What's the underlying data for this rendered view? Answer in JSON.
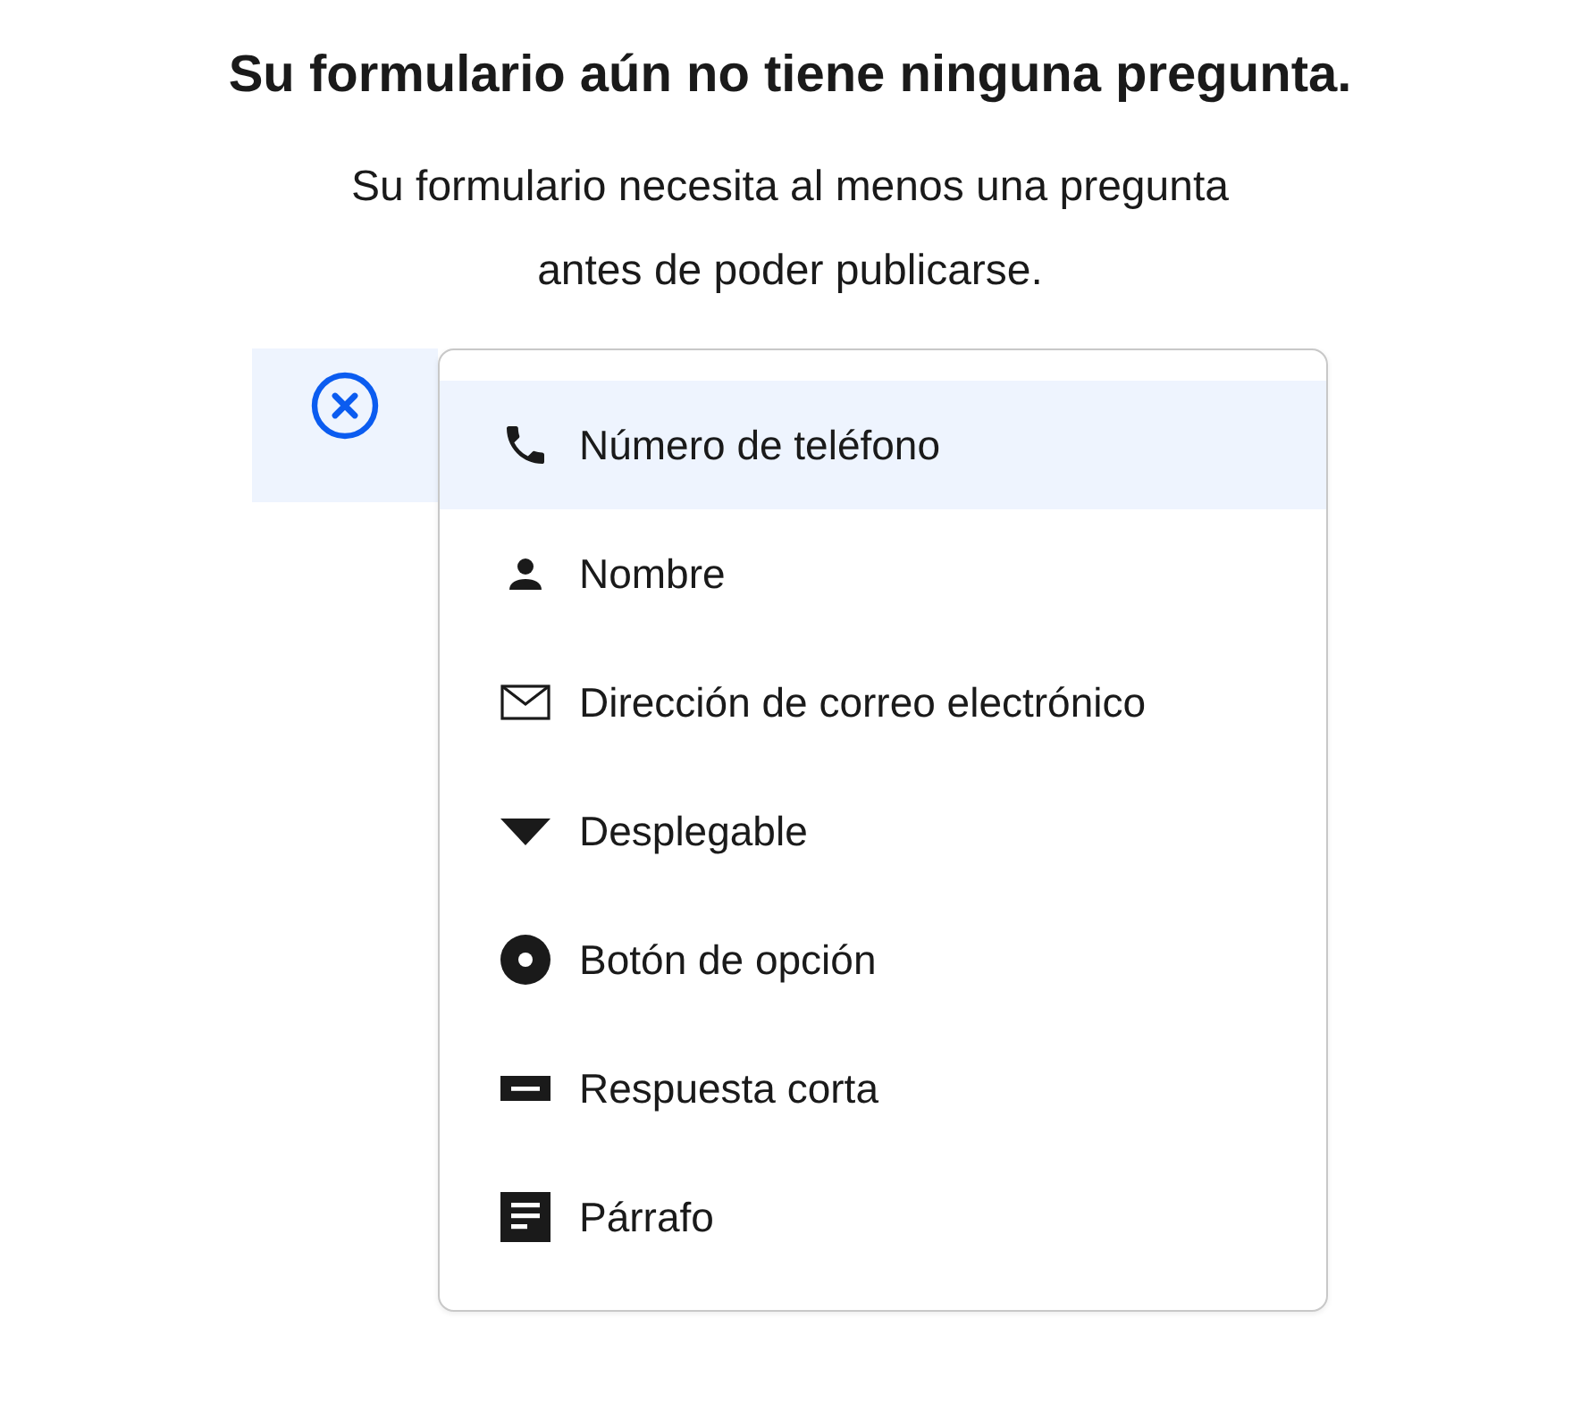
{
  "heading": "Su formulario aún no tiene ninguna pregunta.",
  "description": "Su formulario necesita al menos una pregunta antes de poder publicarse.",
  "menu_items": [
    {
      "kind": "phone",
      "label": "Número de teléfono",
      "selected": true
    },
    {
      "kind": "person",
      "label": "Nombre",
      "selected": false
    },
    {
      "kind": "email",
      "label": "Dirección de correo electrónico",
      "selected": false
    },
    {
      "kind": "dropdown",
      "label": "Desplegable",
      "selected": false
    },
    {
      "kind": "radio",
      "label": "Botón de opción",
      "selected": false
    },
    {
      "kind": "short",
      "label": "Respuesta corta",
      "selected": false
    },
    {
      "kind": "paragraph",
      "label": "Párrafo",
      "selected": false
    }
  ]
}
